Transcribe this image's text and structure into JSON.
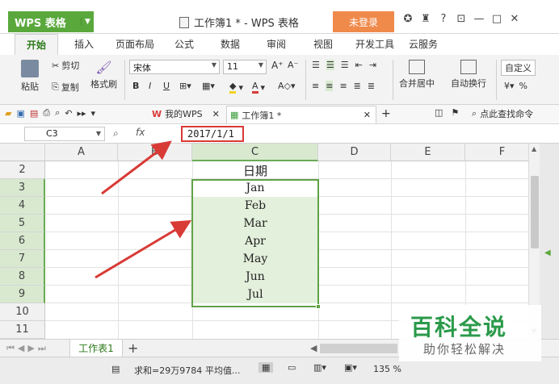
{
  "titlebar": {
    "app_label": "WPS 表格",
    "doc_title": "工作簿1 * - WPS 表格",
    "login_label": "未登录",
    "icons": [
      "settings-icon",
      "shirt-icon",
      "help-icon",
      "restore-icon",
      "minimize-icon",
      "maximize-icon",
      "close-icon"
    ]
  },
  "tabs": [
    "开始",
    "插入",
    "页面布局",
    "公式",
    "数据",
    "审阅",
    "视图",
    "开发工具",
    "云服务"
  ],
  "ribbon": {
    "paste": "粘贴",
    "cut": "剪切",
    "copy": "复制",
    "format_painter": "格式刷",
    "font_name": "宋体",
    "font_size": "11",
    "merge_center": "合并居中",
    "wrap_text": "自动换行",
    "number_format": "自定义",
    "percent": "%"
  },
  "quickbar": {
    "tab_my_wps": "我的WPS",
    "tab_doc": "工作簿1 *",
    "search_label": "点此查找命令"
  },
  "formula": {
    "cell_ref": "C3",
    "fx": "fx",
    "value": "2017/1/1"
  },
  "sheet": {
    "columns": [
      "A",
      "B",
      "C",
      "D",
      "E",
      "F"
    ],
    "rows": [
      "2",
      "3",
      "4",
      "5",
      "6",
      "7",
      "8",
      "9",
      "10",
      "11"
    ],
    "header_cell": "日期",
    "months": [
      "Jan",
      "Feb",
      "Mar",
      "Apr",
      "May",
      "Jun",
      "Jul"
    ]
  },
  "sheettabs": {
    "sheet1": "工作表1",
    "add": "+"
  },
  "status": {
    "sum": "求和=29万9784",
    "avg": "平均值...",
    "zoom": "135 %"
  },
  "watermark": {
    "line1": "百科全说",
    "line2": "助你轻松解决"
  }
}
